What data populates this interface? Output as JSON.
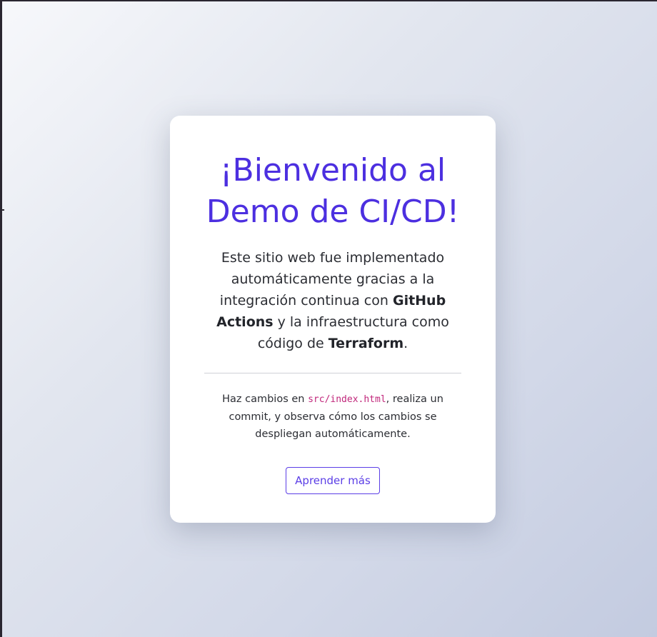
{
  "title": {
    "line1": "¡Bienvenido al",
    "line2": "Demo de CI/CD!"
  },
  "lead": {
    "part1": "Este sitio web fue implementado automáticamente gracias a la integración continua con ",
    "strong1": "GitHub Actions",
    "part2": " y la infraestructura como código de ",
    "strong2": "Terraform",
    "part3": "."
  },
  "note": {
    "part1": "Haz cambios en ",
    "code": "src/index.html",
    "part2": ", realiza un commit, y observa cómo los cambios se despliegan automáticamente."
  },
  "button": {
    "label": "Aprender más"
  },
  "colors": {
    "accent": "#4c2fe0",
    "code": "#c1277b"
  }
}
